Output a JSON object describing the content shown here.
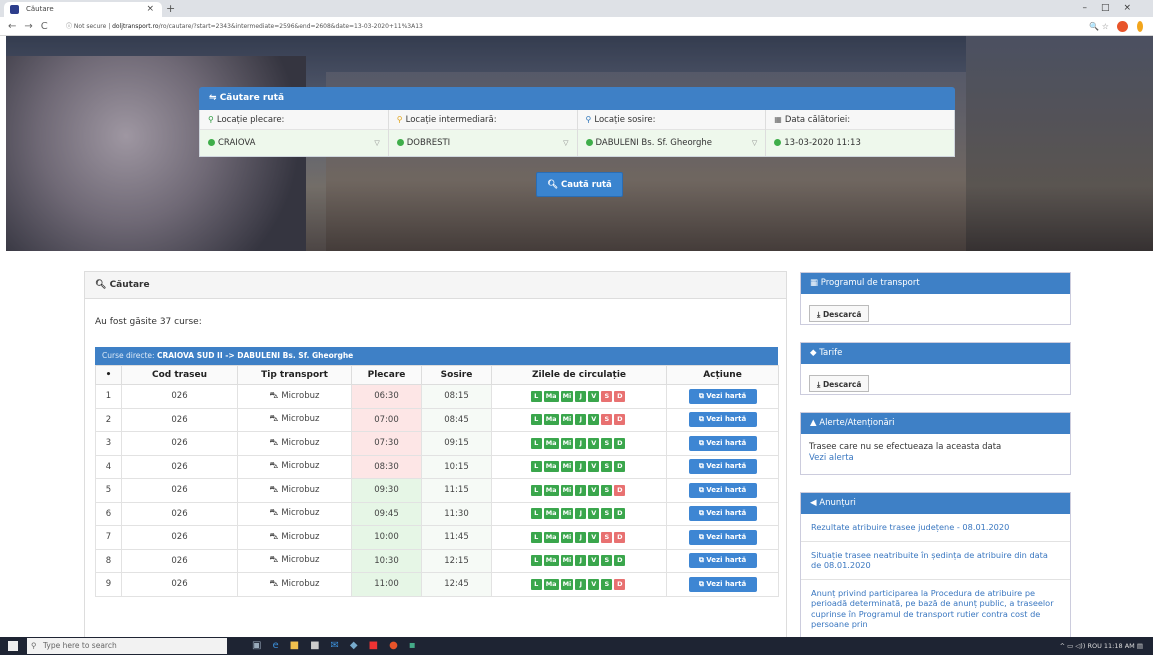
{
  "browser": {
    "tab_title": "Căutare",
    "tab_close": "×",
    "new_tab": "+",
    "window_controls": "–□×",
    "nav_icons": "←→C",
    "security": "ⓘ Not secure",
    "domain": "doljtransport.ro",
    "url_path": "/ro/cautare/?start=2343&intermediate=2596&end=2608&date=13-03-2020+11%3A13",
    "addr_icons": "🔍 ☆"
  },
  "search": {
    "title": "Căutare rută",
    "fields": [
      {
        "label": "Locație plecare:",
        "value": "CRAIOVA"
      },
      {
        "label": "Locație intermediară:",
        "value": "DOBRESTI"
      },
      {
        "label": "Locație sosire:",
        "value": "DABULENI Bs. Sf. Gheorghe"
      },
      {
        "label": "Data călătoriei:",
        "value": "13-03-2020 11:13"
      }
    ],
    "button": "Caută rută"
  },
  "results": {
    "header": "Căutare",
    "count_text": "Au fost găsite 37 curse:",
    "table_title_prefix": "Curse directe: ",
    "table_title_route": "CRAIOVA SUD II -> DABULENI Bs. Sf. Gheorghe",
    "columns": [
      "•",
      "Cod traseu",
      "Tip transport",
      "Plecare",
      "Sosire",
      "Zilele de circulație",
      "Acțiune"
    ],
    "day_labels": [
      "L",
      "Ma",
      "Mi",
      "J",
      "V",
      "S",
      "D"
    ],
    "map_button": "Vezi hartă",
    "rows": [
      {
        "n": "1",
        "code": "026",
        "type": "Microbuz",
        "dep": "06:30",
        "arr": "08:15",
        "days": [
          1,
          1,
          1,
          1,
          1,
          0,
          0
        ],
        "dep_ok": false
      },
      {
        "n": "2",
        "code": "026",
        "type": "Microbuz",
        "dep": "07:00",
        "arr": "08:45",
        "days": [
          1,
          1,
          1,
          1,
          1,
          0,
          0
        ],
        "dep_ok": false
      },
      {
        "n": "3",
        "code": "026",
        "type": "Microbuz",
        "dep": "07:30",
        "arr": "09:15",
        "days": [
          1,
          1,
          1,
          1,
          1,
          1,
          1
        ],
        "dep_ok": false
      },
      {
        "n": "4",
        "code": "026",
        "type": "Microbuz",
        "dep": "08:30",
        "arr": "10:15",
        "days": [
          1,
          1,
          1,
          1,
          1,
          1,
          1
        ],
        "dep_ok": false
      },
      {
        "n": "5",
        "code": "026",
        "type": "Microbuz",
        "dep": "09:30",
        "arr": "11:15",
        "days": [
          1,
          1,
          1,
          1,
          1,
          1,
          0
        ],
        "dep_ok": true
      },
      {
        "n": "6",
        "code": "026",
        "type": "Microbuz",
        "dep": "09:45",
        "arr": "11:30",
        "days": [
          1,
          1,
          1,
          1,
          1,
          1,
          1
        ],
        "dep_ok": true
      },
      {
        "n": "7",
        "code": "026",
        "type": "Microbuz",
        "dep": "10:00",
        "arr": "11:45",
        "days": [
          1,
          1,
          1,
          1,
          1,
          0,
          0
        ],
        "dep_ok": true
      },
      {
        "n": "8",
        "code": "026",
        "type": "Microbuz",
        "dep": "10:30",
        "arr": "12:15",
        "days": [
          1,
          1,
          1,
          1,
          1,
          1,
          1
        ],
        "dep_ok": true
      },
      {
        "n": "9",
        "code": "026",
        "type": "Microbuz",
        "dep": "11:00",
        "arr": "12:45",
        "days": [
          1,
          1,
          1,
          1,
          1,
          1,
          0
        ],
        "dep_ok": true
      }
    ]
  },
  "sidebar": {
    "program": {
      "title": "Programul de transport",
      "button": "Descarcă"
    },
    "tarife": {
      "title": "Tarife",
      "button": "Descarcă"
    },
    "alerts": {
      "title": "Alerte/Atenționări",
      "text": "Trasee care nu se efectueaza la aceasta data",
      "link": "Vezi alerta"
    },
    "news": {
      "title": "Anunțuri",
      "items": [
        "Rezultate atribuire trasee județene - 08.01.2020",
        "Situație trasee neatribuite în ședința de atribuire din data de 08.01.2020",
        "Anunț privind participarea la Procedura de atribuire pe perioadă determinată, pe bază de anunț public, a traseelor cuprinse în Programul de transport rutier contra cost de persoane prin"
      ]
    }
  },
  "taskbar": {
    "search_placeholder": "Type here to search",
    "tray_text": "ROU",
    "time": "11:18 AM"
  },
  "colors": {
    "accent": "#3e80c6",
    "green": "#3aa64c",
    "red": "#e87171"
  }
}
